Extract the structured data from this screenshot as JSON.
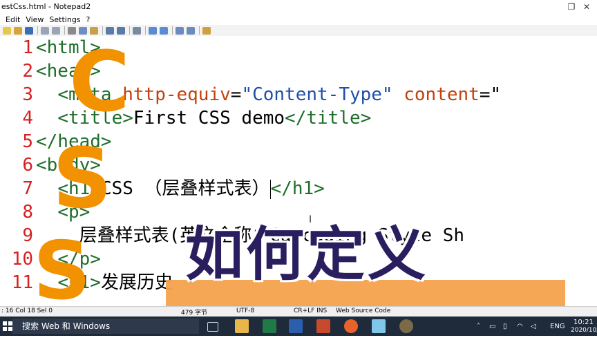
{
  "window": {
    "title": "estCss.html - Notepad2",
    "controls": {
      "restore": "❐",
      "close": "✕"
    }
  },
  "menu": {
    "items": [
      "Edit",
      "View",
      "Settings",
      "?"
    ]
  },
  "editor": {
    "line_numbers": [
      "1",
      "2",
      "3",
      "4",
      "5",
      "6",
      "7",
      "8",
      "9",
      "10",
      "11"
    ],
    "lines": {
      "l1": {
        "tag": "<html>"
      },
      "l2": {
        "tag": "<head>"
      },
      "l3": {
        "indent": "  ",
        "tag1": "<meta ",
        "attr1": "http-equiv",
        "eq1": "=",
        "val1": "\"Content-Type\"",
        "sp": " ",
        "attr2": "content",
        "eq2": "=\""
      },
      "l4": {
        "indent": "  ",
        "tag1": "<title>",
        "text": "First CSS demo",
        "tag2": "</title>"
      },
      "l5": {
        "tag": "</head>"
      },
      "l6": {
        "tag": "<body>"
      },
      "l7": {
        "indent": "  ",
        "tag1": "<h1>",
        "text": "CSS （层叠样式表）",
        "tag2": "</h1>"
      },
      "l8": {
        "indent": "  ",
        "tag": "<p>"
      },
      "l9": {
        "indent": "    ",
        "text": "层叠样式表(英文全称：Cascading Style Sh"
      },
      "l10": {
        "indent": "  ",
        "tag": "</p>"
      },
      "l11": {
        "indent": "  ",
        "tag1": "<h1>",
        "text": "发展历史"
      }
    }
  },
  "overlay": {
    "letters": [
      "C",
      "S",
      "S"
    ],
    "headline": "如何定义"
  },
  "statusbar": {
    "position": ": 16  Col 18  Sel 0",
    "size": "479 字节",
    "encoding": "UTF-8",
    "eol": "CR+LF  INS",
    "scheme": "Web Source Code"
  },
  "taskbar": {
    "search_placeholder": "搜索 Web 和 Windows",
    "language": "ENG",
    "time": "10:21",
    "date": "2020/10/"
  },
  "colors": {
    "line_number": "#d62020",
    "tag": "#1e6e2a",
    "attribute": "#c2410c",
    "value": "#1f4fa8",
    "overlay_orange": "#f39200",
    "headline": "#2a1e5e",
    "taskbar": "#1f2a3a"
  }
}
